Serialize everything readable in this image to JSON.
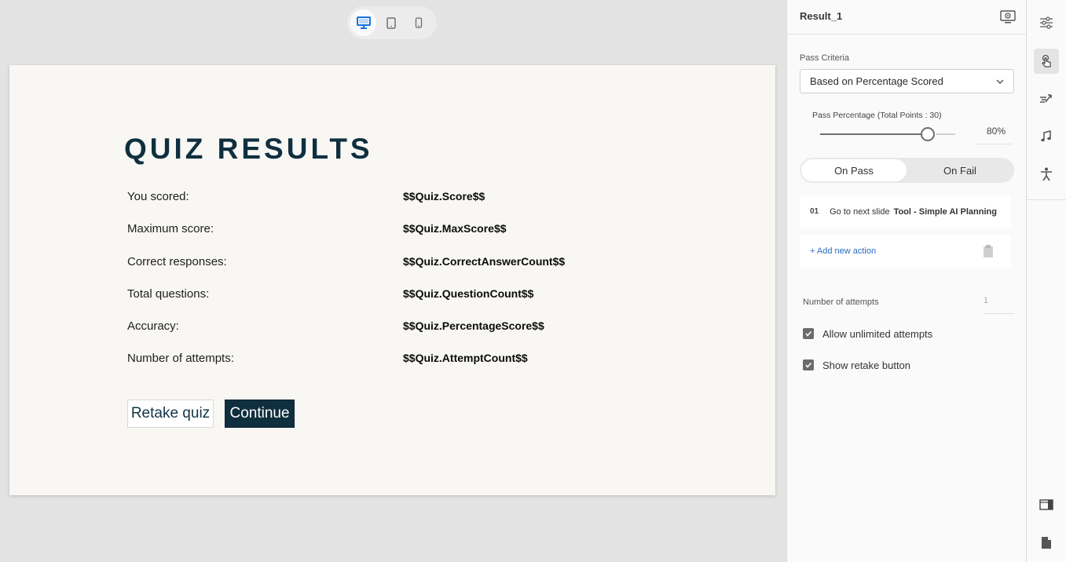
{
  "device_toggle": {
    "items": [
      {
        "name": "desktop",
        "active": true
      },
      {
        "name": "tablet",
        "active": false
      },
      {
        "name": "mobile",
        "active": false
      }
    ]
  },
  "slide": {
    "title": "QUIZ RESULTS",
    "rows": [
      {
        "label": "You scored:",
        "value": "$$Quiz.Score$$"
      },
      {
        "label": "Maximum score:",
        "value": "$$Quiz.MaxScore$$"
      },
      {
        "label": "Correct responses:",
        "value": "$$Quiz.CorrectAnswerCount$$"
      },
      {
        "label": "Total questions:",
        "value": "$$Quiz.QuestionCount$$"
      },
      {
        "label": "Accuracy:",
        "value": "$$Quiz.PercentageScore$$"
      },
      {
        "label": "Number of attempts:",
        "value": "$$Quiz.AttemptCount$$"
      }
    ],
    "retake_label": "Retake quiz",
    "continue_label": "Continue"
  },
  "panel": {
    "title": "Result_1",
    "pass_criteria_label": "Pass Criteria",
    "pass_criteria_value": "Based on Percentage Scored",
    "pass_percentage_label": "Pass Percentage (Total Points : 30)",
    "pass_percentage_value": "80%",
    "pass_percentage_fraction": 0.8,
    "tabs": {
      "on_pass": "On Pass",
      "on_fail": "On Fail",
      "active": "on_pass"
    },
    "action": {
      "number": "01",
      "text": "Go to next slide",
      "target": "Tool - Simple AI Planning"
    },
    "add_action_label": "+ Add new action",
    "attempts_label": "Number of attempts",
    "attempts_value": "1",
    "checkboxes": [
      {
        "label": "Allow unlimited attempts",
        "checked": true
      },
      {
        "label": "Show retake button",
        "checked": true
      }
    ]
  },
  "rail": {
    "top_icons": [
      "sliders-icon",
      "touch-icon",
      "animation-icon",
      "music-icon",
      "accessibility-icon"
    ],
    "bottom_icons": [
      "panel-layout-icon",
      "document-icon"
    ],
    "active_icon": "touch-icon"
  },
  "colors": {
    "accent": "#1473e6",
    "slide_title": "#0f2f3f",
    "continue_button": "#0f2f3f",
    "link": "#2b6cc4"
  }
}
